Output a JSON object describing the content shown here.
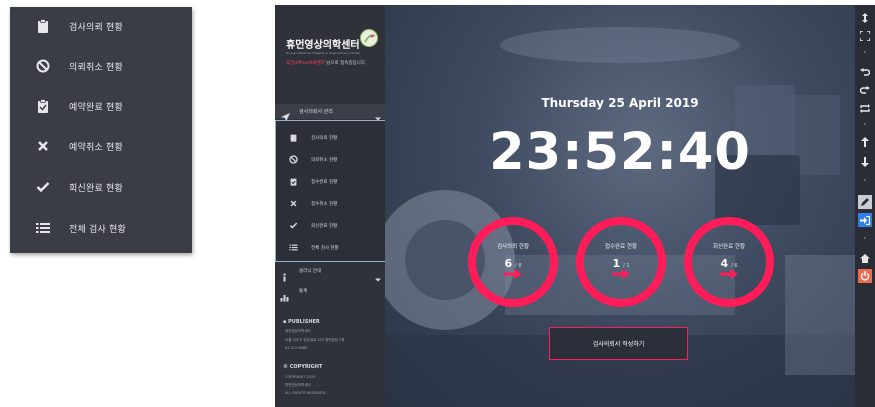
{
  "popup_menu": {
    "items": [
      {
        "label": "검사의뢰 현황",
        "icon": "clipboard-icon"
      },
      {
        "label": "의뢰취소 현황",
        "icon": "ban-icon"
      },
      {
        "label": "예약완료 현황",
        "icon": "clipboard-check-icon"
      },
      {
        "label": "예약취소 현황",
        "icon": "times-icon"
      },
      {
        "label": "회신완료 현황",
        "icon": "check-icon"
      },
      {
        "label": "전체 검사 현황",
        "icon": "list-icon"
      }
    ]
  },
  "sidebar": {
    "brand_title": "휴먼영상의학센터",
    "brand_subtitle": "Human Medical Imaging & Intervention Center",
    "welcome_user": "휴먼offline의뢰센터",
    "welcome_suffix": " 님으로 접속중입니다.",
    "nav_header": "검사의뢰서 관리",
    "sub_items": [
      {
        "label": "검사의뢰 현황",
        "icon": "clipboard-icon"
      },
      {
        "label": "의뢰취소 현황",
        "icon": "ban-icon"
      },
      {
        "label": "접수완료 현황",
        "icon": "clipboard-check-icon"
      },
      {
        "label": "접수취소 현황",
        "icon": "times-icon"
      },
      {
        "label": "회신완료 현황",
        "icon": "check-icon"
      },
      {
        "label": "전체 검사 현황",
        "icon": "list-icon"
      }
    ],
    "nav_info": "클리닉 안내",
    "nav_stats": "통계",
    "publisher_heading": "PUBLISHER",
    "publisher_lines": [
      "휴먼영상의학센터",
      "서울 서초구 강남대로 233 휴먼빌딩 3층",
      "02.512.6685"
    ],
    "copyright_heading": "COPYRIGHT",
    "copyright_lines": [
      "COPYRIGHT 2015",
      "휴먼영상의학센터",
      "ALL RIGHTS RESERVED."
    ]
  },
  "dashboard": {
    "date": "Thursday 25 April 2019",
    "time": "23:52:40",
    "stats": [
      {
        "label": "검사의뢰 현황",
        "value": "6",
        "total": "/ 8"
      },
      {
        "label": "접수완료 현황",
        "value": "1",
        "total": "/ 1"
      },
      {
        "label": "회신완료 현황",
        "value": "4",
        "total": "/ 6"
      }
    ],
    "cta_label": "검사의뢰서 작성하기"
  },
  "colors": {
    "accent": "#ff1c59",
    "sidebar_bg": "#2f323a",
    "active_tool": "#2f80ed",
    "power": "#f06a4e"
  },
  "toolbar_icons": [
    "expand-vertical-icon",
    "fullscreen-icon",
    "undo-icon",
    "redo-icon",
    "loop-icon",
    "arrow-up-icon",
    "arrow-down-icon",
    "pen-icon",
    "sign-in-icon",
    "home-icon",
    "power-icon"
  ]
}
